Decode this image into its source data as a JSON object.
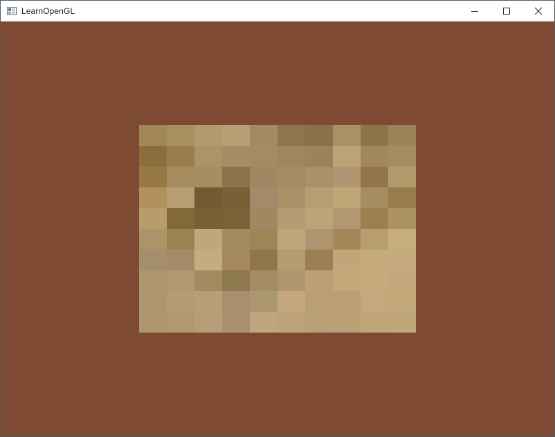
{
  "window": {
    "title": "LearnOpenGL",
    "icon": "opengl-window-icon",
    "controls": {
      "minimize_icon": "minimize-icon",
      "maximize_icon": "maximize-icon",
      "close_icon": "close-icon"
    }
  },
  "scene": {
    "clear_color": "#7f4a33",
    "texture_tiles": {
      "columns": 10,
      "rows": 10,
      "colors": [
        [
          "#a48758",
          "#a8915f",
          "#b39a6c",
          "#b89e74",
          "#a38a62",
          "#8f7450",
          "#8a7149",
          "#aa9164",
          "#8c7649",
          "#9c845a"
        ],
        [
          "#8b6e3b",
          "#9a7f4c",
          "#ad9466",
          "#a78d65",
          "#a38b62",
          "#a08660",
          "#9c835c",
          "#bea377",
          "#a3875f",
          "#a58a62"
        ],
        [
          "#987845",
          "#a78d60",
          "#a68e62",
          "#8e7249",
          "#a18661",
          "#a58b65",
          "#a99169",
          "#b09772",
          "#947547",
          "#b29a6d"
        ],
        [
          "#b1925f",
          "#b79d6f",
          "#735a32",
          "#7a5f39",
          "#a6896a",
          "#aa9068",
          "#b79e75",
          "#c1a677",
          "#a88c63",
          "#987c4b"
        ],
        [
          "#b89d6a",
          "#836838",
          "#7a5f35",
          "#7c6038",
          "#a18762",
          "#b59c74",
          "#bda478",
          "#b29772",
          "#9b7f50",
          "#ad9262"
        ],
        [
          "#ac9368",
          "#9d8251",
          "#c1a67a",
          "#a48a5f",
          "#9e8456",
          "#bfa57a",
          "#b09570",
          "#a4885a",
          "#b89e6f",
          "#c7ad7c"
        ],
        [
          "#a58e6b",
          "#a48a67",
          "#c7ab80",
          "#a6885e",
          "#8f7548",
          "#b79b70",
          "#9a7f52",
          "#c2a679",
          "#c6ab7c",
          "#c5ab7d"
        ],
        [
          "#ae966e",
          "#b09872",
          "#a48a61",
          "#8f7a4f",
          "#a68c64",
          "#b09670",
          "#bda075",
          "#c5a878",
          "#c6aa7a",
          "#c4a87b"
        ],
        [
          "#ad9670",
          "#b29b75",
          "#b69e77",
          "#a88f6f",
          "#ad9672",
          "#c6a77d",
          "#bc9e74",
          "#bb9f73",
          "#c5a87c",
          "#c3a87a"
        ],
        [
          "#ae966f",
          "#b09873",
          "#b69d78",
          "#a9916f",
          "#bfa680",
          "#bea279",
          "#b9a077",
          "#bca076",
          "#c0a579",
          "#c1a67a"
        ]
      ]
    }
  }
}
